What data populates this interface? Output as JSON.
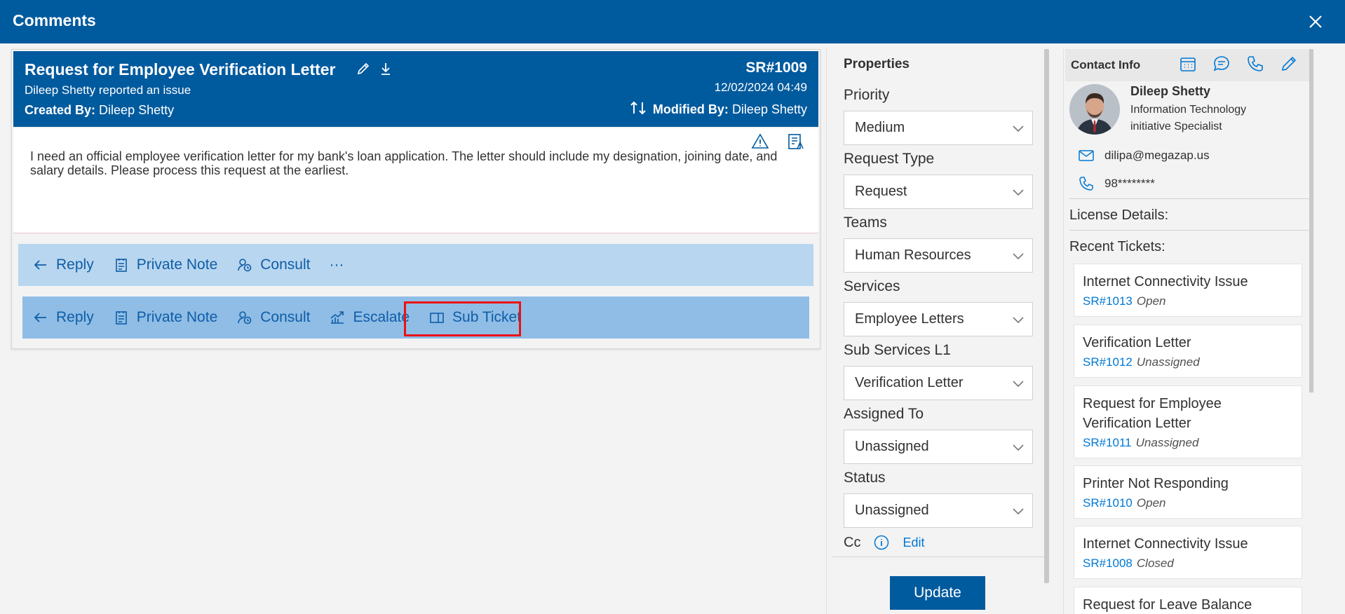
{
  "window": {
    "title": "Comments"
  },
  "ticket": {
    "title": "Request for Employee Verification Letter",
    "reported": "Dileep Shetty reported an issue",
    "created_label": "Created By:",
    "created_by": "Dileep Shetty",
    "sr_number": "SR#1009",
    "date": "12/02/2024 04:49",
    "modified_label": "Modified By:",
    "modified_by": "Dileep Shetty",
    "description": "I need an official employee verification letter for my bank's loan application. The letter should include my designation, joining date, and salary details. Please process this request at the earliest."
  },
  "actions_primary": {
    "reply": "Reply",
    "private_note": "Private Note",
    "consult": "Consult",
    "more": "···"
  },
  "actions_secondary": {
    "reply": "Reply",
    "private_note": "Private Note",
    "consult": "Consult",
    "escalate": "Escalate",
    "sub_ticket": "Sub Ticket"
  },
  "properties": {
    "heading": "Properties",
    "priority": {
      "label": "Priority",
      "value": "Medium"
    },
    "request_type": {
      "label": "Request Type",
      "value": "Request"
    },
    "teams": {
      "label": "Teams",
      "value": "Human Resources"
    },
    "services": {
      "label": "Services",
      "value": "Employee Letters"
    },
    "sub_services": {
      "label": "Sub Services L1",
      "value": "Verification Letter"
    },
    "assigned_to": {
      "label": "Assigned To",
      "value": "Unassigned"
    },
    "status": {
      "label": "Status",
      "value": "Unassigned"
    },
    "cc": {
      "label": "Cc",
      "edit": "Edit"
    },
    "update_button": "Update"
  },
  "contact": {
    "heading": "Contact Info",
    "name": "Dileep Shetty",
    "role": "Information Technology initiative Specialist",
    "email": "dilipa@megazap.us",
    "phone": "98********",
    "license_label": "License Details:",
    "recent_label": "Recent Tickets:",
    "recent_tickets": [
      {
        "title": "Internet Connectivity Issue",
        "sr": "SR#1013",
        "status": "Open"
      },
      {
        "title": "Verification Letter",
        "sr": "SR#1012",
        "status": "Unassigned"
      },
      {
        "title": "Request for Employee Verification Letter",
        "sr": "SR#1011",
        "status": "Unassigned"
      },
      {
        "title": "Printer Not Responding",
        "sr": "SR#1010",
        "status": "Open"
      },
      {
        "title": "Internet Connectivity Issue",
        "sr": "SR#1008",
        "status": "Closed"
      },
      {
        "title": "Request for Leave Balance",
        "sr": "",
        "status": ""
      }
    ]
  },
  "colors": {
    "brand": "#005a9e",
    "link": "#0078d4",
    "action_bar_1": "#b8d6ef",
    "action_bar_2": "#8fbde6",
    "highlight": "#ee1111"
  }
}
